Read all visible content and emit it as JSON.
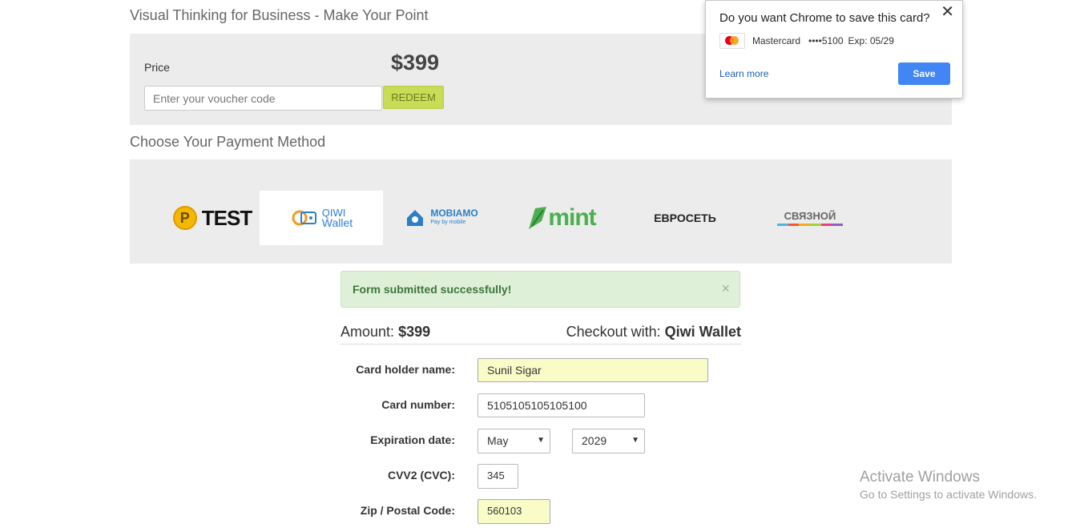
{
  "product": {
    "title": "Visual Thinking for Business - Make Your Point"
  },
  "pricing": {
    "price_label": "Price",
    "price_value": "$399",
    "voucher_placeholder": "Enter your voucher code",
    "redeem_label": "REDEEM"
  },
  "payment": {
    "section_title": "Choose Your Payment Method",
    "methods": [
      {
        "id": "test",
        "coin": "P",
        "label": "TEST",
        "selected": false
      },
      {
        "id": "qiwi",
        "line1": "QIWI",
        "line2": "Wallet",
        "selected": true
      },
      {
        "id": "mobiamo",
        "line1": "MOBIAMO",
        "line2": "Pay by mobile",
        "selected": false
      },
      {
        "id": "mint",
        "label": "mint",
        "selected": false
      },
      {
        "id": "evroset",
        "label": "ЕВРОСЕТЬ",
        "selected": false
      },
      {
        "id": "svyaznoy",
        "label": "СВЯЗНОЙ",
        "selected": false
      }
    ]
  },
  "alert": {
    "message": "Form submitted successfully!",
    "close": "×"
  },
  "summary": {
    "amount_label": "Amount:",
    "amount_value": "$399",
    "checkout_label": "Checkout with:",
    "checkout_value": "Qiwi Wallet"
  },
  "form": {
    "card_holder_label": "Card holder name:",
    "card_holder_value": "Sunil Sigar",
    "card_number_label": "Card number:",
    "card_number_value": "5105105105105100",
    "expiration_label": "Expiration date:",
    "exp_month": "May",
    "exp_year": "2029",
    "cvv_label": "CVV2 (CVC):",
    "cvv_value": "345",
    "zip_label": "Zip / Postal Code:",
    "zip_value": "560103"
  },
  "chrome_popup": {
    "title": "Do you want Chrome to save this card?",
    "close": "✕",
    "card_brand": "Mastercard",
    "card_mask": "••••5100",
    "card_exp": "Exp: 05/29",
    "learn_more": "Learn more",
    "save": "Save"
  },
  "watermark": {
    "title": "Activate Windows",
    "subtitle": "Go to Settings to activate Windows."
  },
  "colors": {
    "panel_bg": "#ececec",
    "redeem_bg": "#c9dc56",
    "alert_bg": "#dff0d8",
    "alert_text": "#3c763d",
    "chrome_blue": "#4285f4",
    "autofill_yellow": "#fafcc8"
  }
}
